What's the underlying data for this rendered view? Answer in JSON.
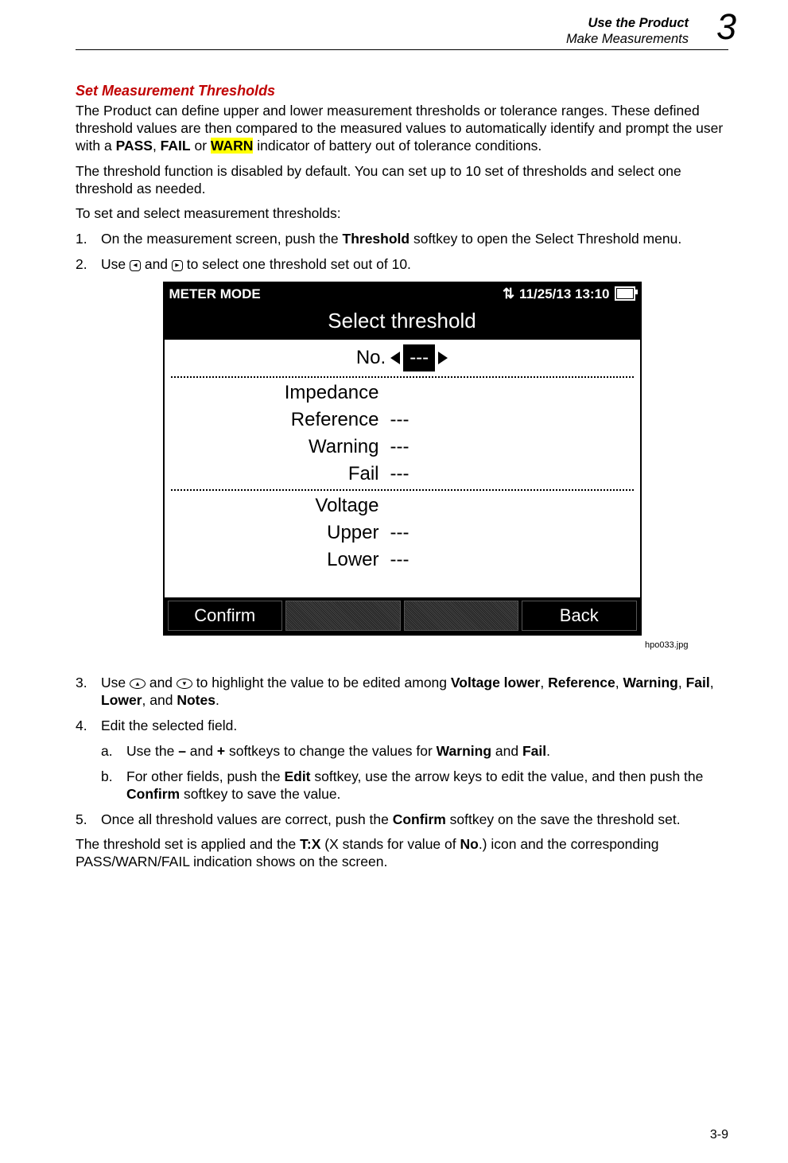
{
  "header": {
    "line1": "Use the Product",
    "line2": "Make Measurements",
    "chapter": "3"
  },
  "section_title": "Set Measurement Thresholds",
  "para1_a": "The Product can define upper and lower measurement thresholds or tolerance ranges. These defined threshold values are then compared to the measured values to automatically identify and prompt the user with a ",
  "pass": "PASS",
  "sep1": ", ",
  "fail": "FAIL",
  "sep2": " or ",
  "warn": "WARN",
  "para1_b": " indicator of battery out of tolerance conditions.",
  "para2": "The threshold function is disabled by default. You can set up to 10 set of thresholds and select one threshold as needed.",
  "para3": "To set and select measurement thresholds:",
  "steps": {
    "s1_a": "On the measurement screen, push the ",
    "s1_b": "Threshold",
    "s1_c": " softkey to open the Select Threshold menu.",
    "s2_a": "Use ",
    "s2_b": " and ",
    "s2_c": " to select one threshold set out of 10.",
    "s3_a": "Use ",
    "s3_b": " and ",
    "s3_c": " to highlight the value to be edited among ",
    "s3_d": "Voltage lower",
    "s3_e": "Reference",
    "s3_f": "Warning",
    "s3_g": "Fail",
    "s3_h": "Lower",
    "s3_i": "Notes",
    "s4": "Edit the selected field.",
    "s4a_a": "Use the ",
    "s4a_minus": "–",
    "s4a_b": " and ",
    "s4a_plus": "+",
    "s4a_c": " softkeys to change the values for ",
    "s4a_d": "Warning",
    "s4a_e": " and ",
    "s4a_f": "Fail",
    "s4b_a": "For other fields, push the ",
    "s4b_b": "Edit",
    "s4b_c": " softkey, use the arrow keys to edit the value, and then push the ",
    "s4b_d": "Confirm",
    "s4b_e": " softkey to save the value.",
    "s5_a": "Once all threshold values are correct, push the ",
    "s5_b": "Confirm",
    "s5_c": " softkey on the save the threshold set."
  },
  "para4_a": "The threshold set is applied and the ",
  "para4_b": "T:X",
  "para4_c": " (X stands for value of ",
  "para4_d": "No",
  "para4_e": ".) icon and the corresponding PASS/WARN/FAIL indication shows on the screen.",
  "screenshot": {
    "mode": "METER MODE",
    "datetime": "11/25/13 13:10",
    "title": "Select threshold",
    "no_label": "No.",
    "no_value": "---",
    "group1_title": "Impedance",
    "rows1": [
      {
        "label": "Reference",
        "value": "---"
      },
      {
        "label": "Warning",
        "value": "---"
      },
      {
        "label": "Fail",
        "value": "---"
      }
    ],
    "group2_title": "Voltage",
    "rows2": [
      {
        "label": "Upper",
        "value": "---"
      },
      {
        "label": "Lower",
        "value": "---"
      }
    ],
    "soft_left": "Confirm",
    "soft_right": "Back"
  },
  "filename": "hpo033.jpg",
  "pagenum": "3-9",
  "sep_comma": ", ",
  "sep_and": ", and ",
  "period": "."
}
